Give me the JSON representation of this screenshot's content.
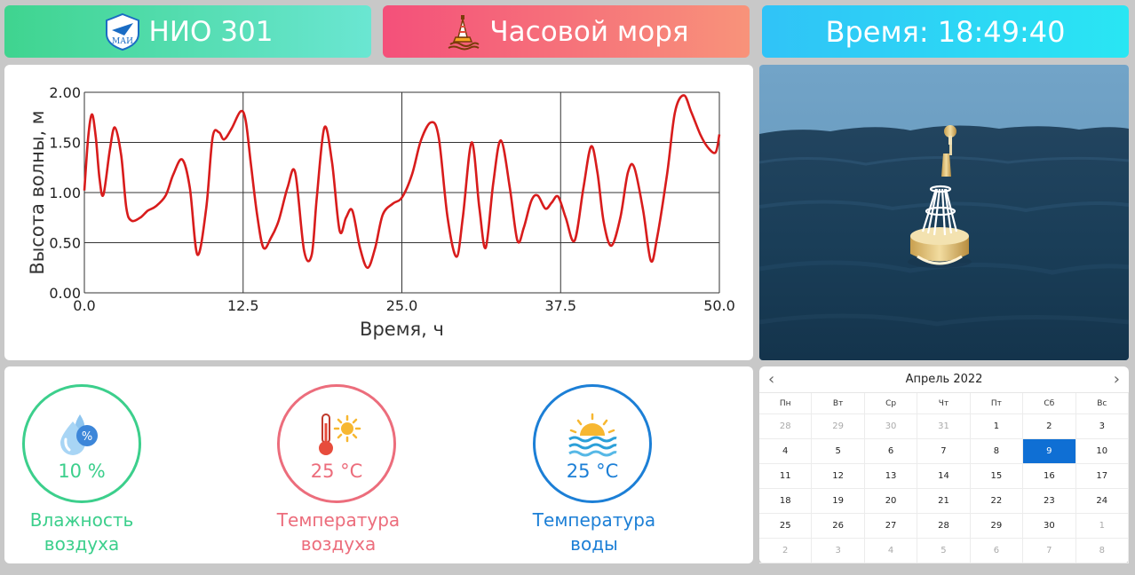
{
  "header": {
    "lab_title": "НИО 301",
    "logo_text": "МАИ",
    "app_title": "Часовой моря",
    "time_text": "Время: 18:49:40"
  },
  "chart_data": {
    "type": "line",
    "xlabel": "Время, ч",
    "ylabel": "Высота волны, м",
    "xlim": [
      0,
      50
    ],
    "ylim": [
      0,
      2
    ],
    "xticks": [
      "0.0",
      "12.5",
      "25.0",
      "37.5",
      "50.0"
    ],
    "yticks": [
      "0.00",
      "0.50",
      "1.00",
      "1.50",
      "2.00"
    ],
    "grid": true,
    "color": "#d81c1c",
    "series": [
      {
        "x": [
          0,
          0.3,
          0.6,
          0.9,
          1.2,
          1.5,
          2.0,
          2.4,
          2.9,
          3.3,
          3.7,
          4.4,
          5.0,
          5.6,
          6.4,
          7.0,
          7.7,
          8.3,
          8.9,
          9.6,
          10.1,
          10.6,
          11.0,
          11.6,
          12.3,
          12.7,
          13.1,
          13.6,
          14.1,
          14.7,
          15.3,
          16.0,
          16.6,
          17.3,
          17.9,
          18.3,
          18.9,
          19.5,
          20.1,
          20.6,
          21.1,
          21.7,
          22.3,
          22.9,
          23.5,
          24.3,
          25.0,
          25.8,
          26.5,
          27.3,
          27.9,
          28.6,
          29.3,
          29.8,
          30.5,
          31.1,
          31.6,
          32.2,
          32.8,
          33.5,
          34.1,
          34.6,
          35.2,
          35.7,
          36.3,
          36.8,
          37.3,
          37.9,
          38.6,
          39.3,
          39.9,
          40.4,
          40.9,
          41.5,
          42.2,
          42.8,
          43.3,
          44.0,
          44.6,
          45.1,
          45.9,
          46.5,
          47.2,
          47.8,
          48.5,
          49.1,
          49.7,
          50.0
        ],
        "y": [
          1.02,
          1.55,
          1.78,
          1.55,
          1.13,
          0.98,
          1.42,
          1.65,
          1.37,
          0.85,
          0.72,
          0.75,
          0.82,
          0.86,
          0.97,
          1.18,
          1.33,
          1.05,
          0.38,
          0.85,
          1.55,
          1.6,
          1.53,
          1.64,
          1.81,
          1.72,
          1.3,
          0.78,
          0.45,
          0.55,
          0.72,
          1.05,
          1.2,
          0.42,
          0.38,
          0.95,
          1.65,
          1.3,
          0.62,
          0.75,
          0.82,
          0.45,
          0.25,
          0.45,
          0.78,
          0.89,
          0.95,
          1.18,
          1.52,
          1.7,
          1.55,
          0.75,
          0.36,
          0.75,
          1.5,
          0.85,
          0.45,
          1.1,
          1.52,
          1.05,
          0.52,
          0.65,
          0.92,
          0.97,
          0.84,
          0.9,
          0.96,
          0.75,
          0.52,
          1.05,
          1.46,
          1.2,
          0.7,
          0.47,
          0.75,
          1.2,
          1.25,
          0.82,
          0.32,
          0.55,
          1.2,
          1.8,
          1.97,
          1.8,
          1.58,
          1.45,
          1.4,
          1.58
        ]
      }
    ]
  },
  "sensors": [
    {
      "label_line1": "Влажность",
      "label_line2": "воздуха",
      "value": "10 %",
      "icon": "humidity-drops-icon",
      "color": "#3ccf8c"
    },
    {
      "label_line1": "Температура",
      "label_line2": "воздуха",
      "value": "25 °C",
      "icon": "thermometer-sun-icon",
      "color": "#ec6d7c"
    },
    {
      "label_line1": "Температура",
      "label_line2": "воды",
      "value": "25 °C",
      "icon": "sun-waves-icon",
      "color": "#1c7fd6"
    }
  ],
  "calendar": {
    "title": "Апрель 2022",
    "prev": "‹",
    "next": "›",
    "weekdays": [
      "Пн",
      "Вт",
      "Ср",
      "Чт",
      "Пт",
      "Сб",
      "Вс"
    ],
    "selected": "9",
    "weeks": [
      [
        "28",
        "29",
        "30",
        "31",
        "1",
        "2",
        "3"
      ],
      [
        "4",
        "5",
        "6",
        "7",
        "8",
        "9",
        "10"
      ],
      [
        "11",
        "12",
        "13",
        "14",
        "15",
        "16",
        "17"
      ],
      [
        "18",
        "19",
        "20",
        "21",
        "22",
        "23",
        "24"
      ],
      [
        "25",
        "26",
        "27",
        "28",
        "29",
        "30",
        "1"
      ],
      [
        "2",
        "3",
        "4",
        "5",
        "6",
        "7",
        "8"
      ]
    ],
    "other_month_first_row_count": 4,
    "other_month_tail_start": "5.6"
  }
}
